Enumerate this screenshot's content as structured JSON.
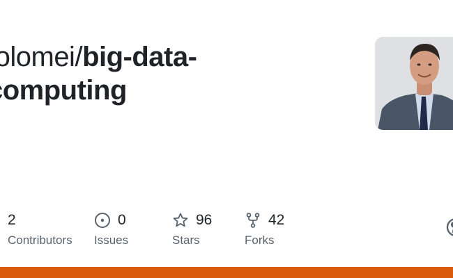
{
  "repo": {
    "owner": "tolomei/",
    "name": "big-data-",
    "name_line2": "computing"
  },
  "stats": {
    "contributors": {
      "value": "2",
      "label": "Contributors",
      "icon": "people-icon"
    },
    "issues": {
      "value": "0",
      "label": "Issues",
      "icon": "issue-opened-icon"
    },
    "stars": {
      "value": "96",
      "label": "Stars",
      "icon": "star-icon"
    },
    "forks": {
      "value": "42",
      "label": "Forks",
      "icon": "repo-forked-icon"
    }
  },
  "colors": {
    "language_bar": "#da5b0b",
    "text_primary": "#1f2328",
    "text_muted": "#59636e",
    "icon": "#59636e"
  },
  "avatar": {
    "icon": "avatar"
  },
  "brand_icon": "github-mark-icon"
}
